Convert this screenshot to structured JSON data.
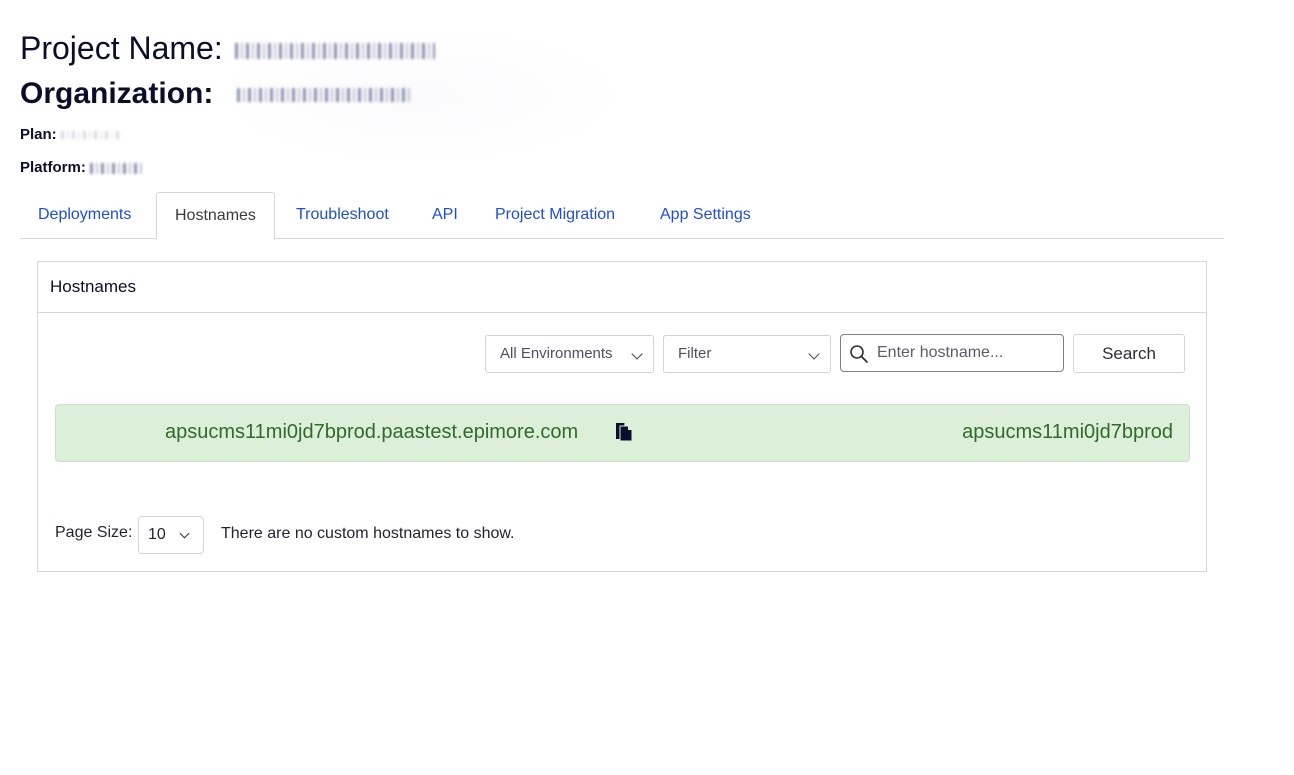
{
  "project": {
    "name_label": "Project Name:",
    "organization_label": "Organization:",
    "plan_label": "Plan:",
    "platform_label": "Platform:"
  },
  "tabs": [
    {
      "label": "Deployments",
      "active": false
    },
    {
      "label": "Hostnames",
      "active": true
    },
    {
      "label": "Troubleshoot",
      "active": false
    },
    {
      "label": "API",
      "active": false
    },
    {
      "label": "Project Migration",
      "active": false
    },
    {
      "label": "App Settings",
      "active": false
    }
  ],
  "panel": {
    "title": "Hostnames",
    "environment_select": "All Environments",
    "filter_select": "Filter",
    "search_placeholder": "Enter hostname...",
    "search_button": "Search"
  },
  "hostnames": [
    {
      "hostname": "apsucms11mi0jd7bprod.paastest.epimore.com",
      "environment": "apsucms11mi0jd7bprod",
      "status_color": "#dcefd9"
    }
  ],
  "footer": {
    "page_size_label": "Page Size:",
    "page_size_value": "10",
    "empty_message": "There are no custom hostnames to show."
  },
  "colors": {
    "link": "#1d4ed8",
    "success_bg": "#dcefd9",
    "success_text": "#2f6b2a"
  },
  "icons": [
    "search-icon",
    "copy-icon",
    "chevron-down-icon"
  ]
}
